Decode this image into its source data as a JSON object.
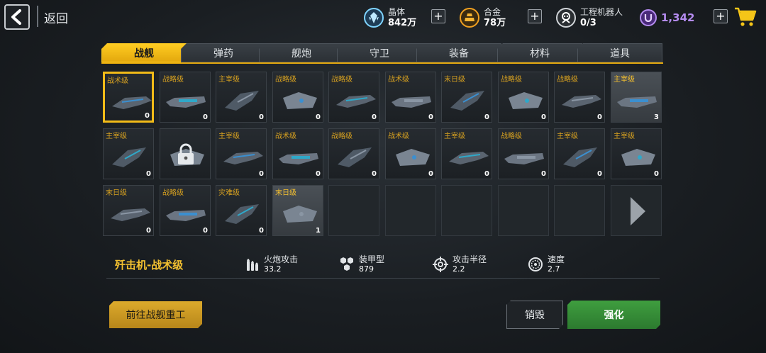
{
  "header": {
    "back_label": "返回",
    "resources": [
      {
        "name": "晶体",
        "value": "842万",
        "icon": "crystal-icon",
        "color": "#7fd4ff"
      },
      {
        "name": "合金",
        "value": "78万",
        "icon": "alloy-icon",
        "color": "#f0a020"
      },
      {
        "name": "工程机器人",
        "value": "0/3",
        "icon": "robot-icon",
        "color": "#e0e0e0"
      }
    ],
    "gems": {
      "value": "1,342",
      "icon": "gem-u-icon",
      "color": "#b58cf0"
    },
    "plus": "+",
    "shop_icon": "cart-icon"
  },
  "tabs": [
    {
      "label": "战舰",
      "active": true
    },
    {
      "label": "弹药",
      "active": false
    },
    {
      "label": "舰炮",
      "active": false
    },
    {
      "label": "守卫",
      "active": false
    },
    {
      "label": "装备",
      "active": false
    },
    {
      "label": "材料",
      "active": false
    },
    {
      "label": "道具",
      "active": false
    }
  ],
  "slots": [
    {
      "grade": "战术级",
      "count": "0",
      "selected": true
    },
    {
      "grade": "战略级",
      "count": "0"
    },
    {
      "grade": "主宰级",
      "count": "0"
    },
    {
      "grade": "战略级",
      "count": "0"
    },
    {
      "grade": "战略级",
      "count": "0"
    },
    {
      "grade": "战术级",
      "count": "0"
    },
    {
      "grade": "末日级",
      "count": "0"
    },
    {
      "grade": "战略级",
      "count": "0"
    },
    {
      "grade": "战略级",
      "count": "0"
    },
    {
      "grade": "主宰级",
      "count": "3",
      "highlight": true
    },
    {
      "grade": "主宰级",
      "count": "0"
    },
    {
      "grade": "",
      "count": "",
      "locked": true
    },
    {
      "grade": "主宰级",
      "count": "0"
    },
    {
      "grade": "战术级",
      "count": "0"
    },
    {
      "grade": "战略级",
      "count": "0"
    },
    {
      "grade": "战术级",
      "count": "0"
    },
    {
      "grade": "主宰级",
      "count": "0"
    },
    {
      "grade": "战略级",
      "count": "0"
    },
    {
      "grade": "主宰级",
      "count": "0"
    },
    {
      "grade": "主宰级",
      "count": "0"
    },
    {
      "grade": "末日级",
      "count": "0"
    },
    {
      "grade": "战略级",
      "count": "0"
    },
    {
      "grade": "灾难级",
      "count": "0"
    },
    {
      "grade": "末日级",
      "count": "1",
      "highlight": true
    },
    {
      "empty": true
    },
    {
      "empty": true
    },
    {
      "empty": true
    },
    {
      "empty": true
    },
    {
      "empty": true
    },
    {
      "next": true
    }
  ],
  "selected_ship": {
    "name": "歼击机-战术级",
    "stats": [
      {
        "label": "火炮攻击",
        "value": "33.2",
        "icon": "ammo-icon"
      },
      {
        "label": "装甲型",
        "value": "879",
        "icon": "armor-hex-icon"
      },
      {
        "label": "攻击半径",
        "value": "2.2",
        "icon": "crosshair-icon"
      },
      {
        "label": "速度",
        "value": "2.7",
        "icon": "speed-gauge-icon"
      }
    ]
  },
  "buttons": {
    "goto_shipyard": "前往战舰重工",
    "destroy": "销毁",
    "upgrade": "强化"
  }
}
